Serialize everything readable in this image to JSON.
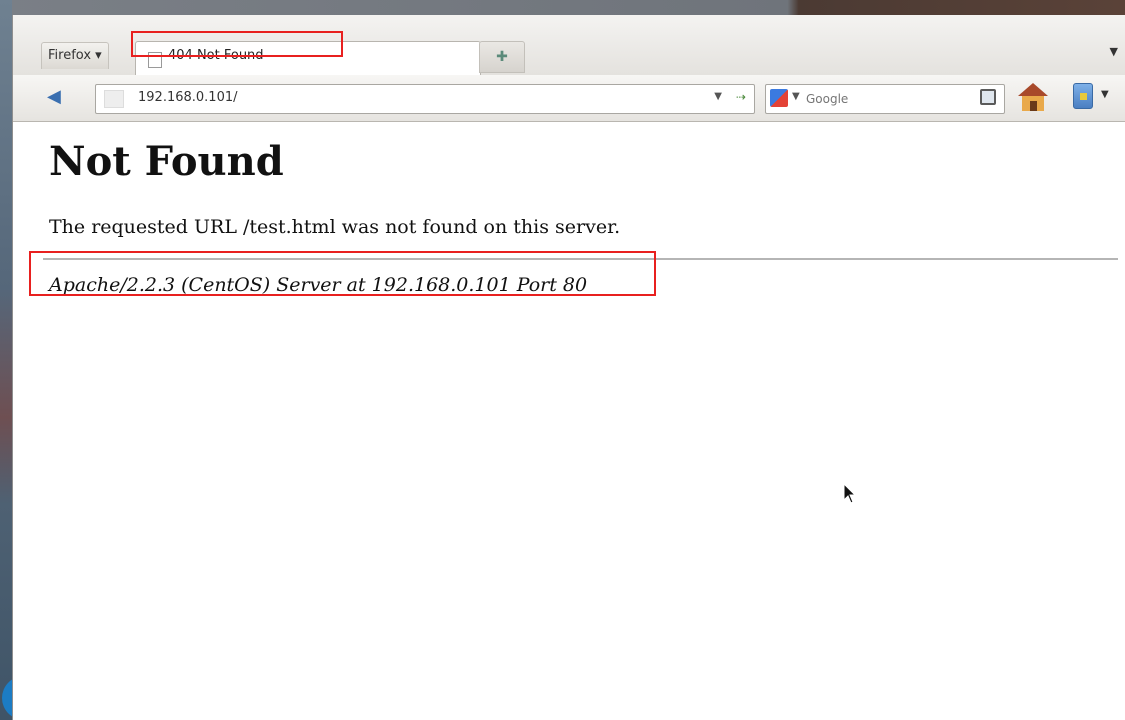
{
  "browser": {
    "menu_label": "Firefox",
    "tab_title": "404 Not Found",
    "new_tab_icon": "plus-icon",
    "url": "192.168.0.101/",
    "search_engine": "Google",
    "search_placeholder": "Google"
  },
  "page": {
    "heading": "Not Found",
    "message": "The requested URL /test.html was not found on this server.",
    "signature": "Apache/2.2.3 (CentOS) Server at 192.168.0.101 Port 80"
  },
  "highlight_color": "#e8201f"
}
